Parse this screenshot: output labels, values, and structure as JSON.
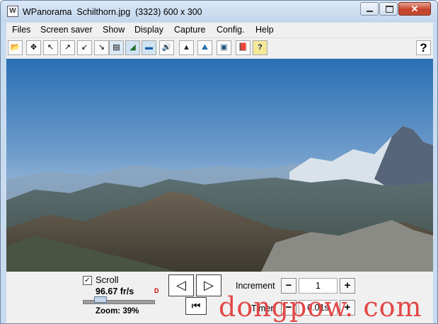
{
  "window": {
    "title": "WPanorama  Schilthorn.jpg  (3323) 600 x 300",
    "app_icon_glyph": "W",
    "close_glyph": "✕"
  },
  "menu": {
    "items": [
      {
        "label": "Files"
      },
      {
        "label": "Screen saver"
      },
      {
        "label": "Show"
      },
      {
        "label": "Display"
      },
      {
        "label": "Capture"
      },
      {
        "label": "Config."
      },
      {
        "label": "Help"
      }
    ]
  },
  "toolbar": {
    "buttons": [
      {
        "icon": "open-folder-icon",
        "glyph": "📂"
      },
      {
        "icon": "move-arrows-icon",
        "glyph": "✥"
      },
      {
        "icon": "arrow-up-left-icon",
        "glyph": "↖"
      },
      {
        "icon": "arrow-up-right-icon",
        "glyph": "↗"
      },
      {
        "icon": "arrow-down-left-icon",
        "glyph": "↙"
      },
      {
        "icon": "arrow-down-right-icon",
        "glyph": "↘"
      },
      {
        "icon": "panorama-view-icon",
        "glyph": "▤"
      },
      {
        "icon": "landscape-icon",
        "glyph": "◢"
      },
      {
        "icon": "horizon-icon",
        "glyph": "▬"
      },
      {
        "icon": "speaker-icon",
        "glyph": "🔊"
      },
      {
        "icon": "mountain-icon",
        "glyph": "▲"
      },
      {
        "icon": "peak-icon",
        "glyph": "⛰"
      },
      {
        "icon": "frame-icon",
        "glyph": "▣"
      },
      {
        "icon": "book-icon",
        "glyph": "📕"
      },
      {
        "icon": "help-book-icon",
        "glyph": "?"
      }
    ],
    "help_glyph": "?"
  },
  "controls": {
    "scroll_checked_glyph": "✓",
    "scroll_label": "Scroll",
    "frame_rate": "96.67 fr/s",
    "red_icon_glyph": "D",
    "zoom_label": "Zoom: 39%",
    "prev_glyph": "◁",
    "next_glyph": "▷",
    "first_glyph": "⏮",
    "increment_label": "Increment",
    "increment_value": "1",
    "timer_label": "Timer",
    "timer_value": "0.01s",
    "minus_glyph": "−",
    "plus_glyph": "+"
  },
  "watermark": "dongpow. com",
  "colors": {
    "sky_top": "#2a6fb4",
    "sky_bottom": "#b5cde0",
    "watermark": "#e34747"
  }
}
